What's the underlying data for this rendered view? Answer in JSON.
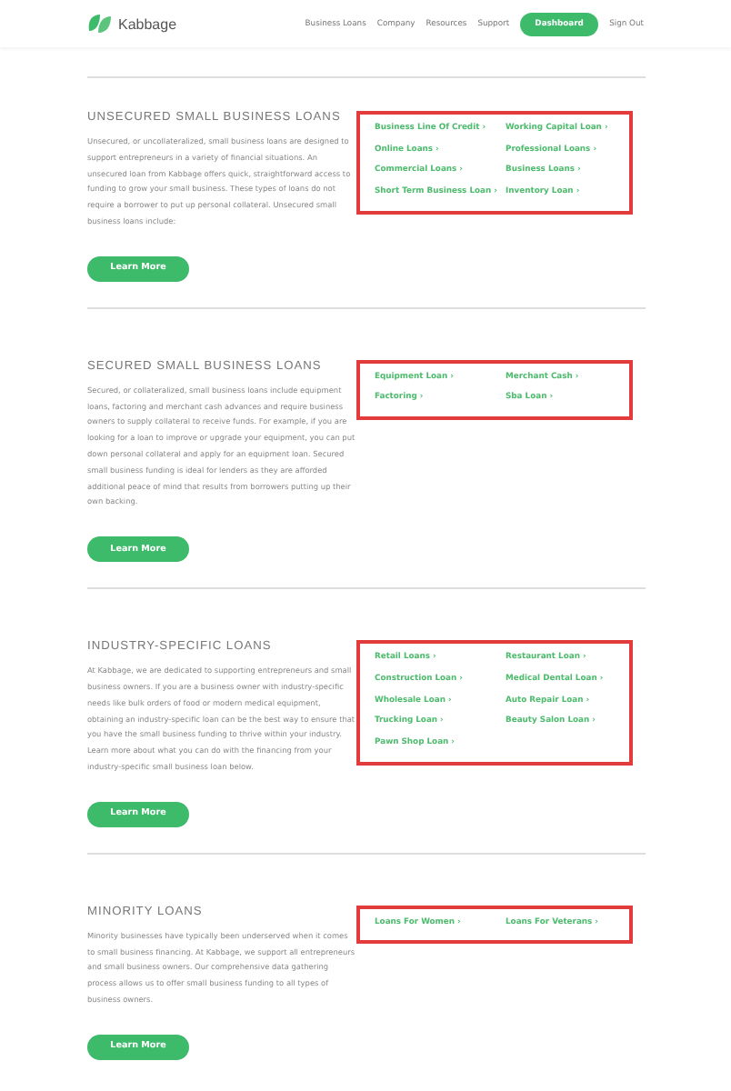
{
  "header": {
    "logo": "Kabbage",
    "nav": [
      {
        "label": "Business Loans",
        "kind": "link"
      },
      {
        "label": "Company",
        "kind": "link"
      },
      {
        "label": "Resources",
        "kind": "link"
      },
      {
        "label": "Support",
        "kind": "link"
      },
      {
        "label": "Dashboard",
        "kind": "button"
      },
      {
        "label": "Sign Out",
        "kind": "link"
      }
    ]
  },
  "sections": [
    {
      "title": "UNSECURED SMALL BUSINESS LOANS",
      "description": "Unsecured, or uncollateralized, small business loans are designed to support entrepreneurs in a variety of financial situations. An unsecured loan from Kabbage offers quick, straightforward access to funding to grow your small business. These types of loans do not require a borrower to put up personal collateral. Unsecured small business loans include:",
      "highlighted": true,
      "links": [
        "Business Line Of Credit ›",
        "Working Capital Loan ›",
        "Online Loans ›",
        "Professional Loans ›",
        "Commercial Loans ›",
        "Business Loans ›",
        "Short Term Business Loan ›",
        "Inventory Loan ›"
      ],
      "button": "Learn More"
    },
    {
      "title": "SECURED SMALL BUSINESS LOANS",
      "description": "Secured, or collateralized, small business loans include equipment loans, factoring and merchant cash advances and require business owners to supply collateral to receive funds. For example, if you are looking for a loan to improve or upgrade your equipment, you can put down personal collateral and apply for an equipment loan. Secured small business funding is ideal for lenders as they are afforded additional peace of mind that results from borrowers putting up their own backing.",
      "highlighted": true,
      "links": [
        "Equipment Loan ›",
        "Merchant Cash ›",
        "Factoring ›",
        "Sba Loan ›"
      ],
      "button": "Learn More"
    },
    {
      "title": "INDUSTRY-SPECIFIC LOANS",
      "description": "At Kabbage, we are dedicated to supporting entrepreneurs and small business owners. If you are a business owner with industry-specific needs like bulk orders of food or modern medical equipment, obtaining an industry-specific loan can be the best way to ensure that you have the small business funding to thrive within your industry. Learn more about what you can do with the financing from your industry-specific small business loan below.",
      "highlighted": true,
      "links": [
        "Retail Loans ›",
        "Restaurant Loan ›",
        "Construction Loan ›",
        "Medical Dental Loan ›",
        "Wholesale Loan ›",
        "Auto Repair Loan ›",
        "Trucking Loan ›",
        "Beauty Salon Loan ›",
        "Pawn Shop Loan ›"
      ],
      "button": "Learn More"
    },
    {
      "title": "MINORITY LOANS",
      "description": "Minority businesses have typically been underserved when it comes to small business financing. At Kabbage, we support all entrepreneurs and small business owners. Our comprehensive data gathering process allows us to offer small business funding to all types of business owners.",
      "highlighted": true,
      "links": [
        "Loans For Women ›",
        "Loans For Veterans ›"
      ],
      "button": "Learn More"
    }
  ]
}
